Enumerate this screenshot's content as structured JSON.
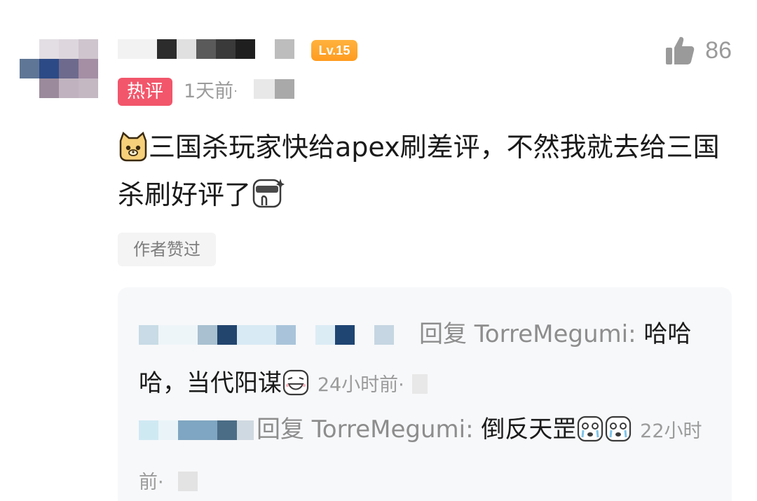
{
  "comment": {
    "level": "Lv.15",
    "likes": "86",
    "hot_tag": "热评",
    "time": "1天前",
    "time_dot": "·",
    "text_part1": "三国杀玩家快给apex刷差评，不然我就去给三国杀刷好评了",
    "author_liked": "作者赞过",
    "emoji_start": "cat-face-emoji",
    "emoji_end": "sunglasses-wow-emoji"
  },
  "replies": [
    {
      "prefix": "回复 TorreMegumi:",
      "text": " 哈哈哈，当代阳谋",
      "emoji": "grin-emoji",
      "time": "24小时前",
      "time_dot": "·"
    },
    {
      "prefix": "回复 TorreMegumi:",
      "text": " 倒反天罡",
      "emoji": "crying-emoji",
      "time": "22小时前",
      "time_dot": "·"
    }
  ],
  "colors": {
    "hot_tag_bg": "#f2566b",
    "level_badge": "#ffa52c",
    "secondary_text": "#9b9b9b",
    "primary_text": "#1a1a1a",
    "reply_bg": "#f7f8fa"
  }
}
